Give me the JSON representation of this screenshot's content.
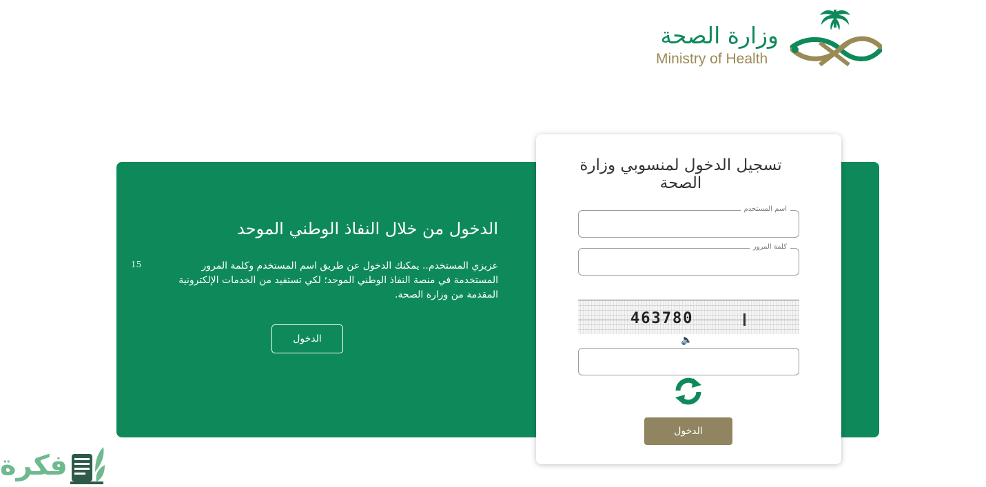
{
  "header": {
    "logo_arabic": "وزارة الصحة",
    "logo_english": "Ministry of Health"
  },
  "nafath": {
    "title": "الدخول من خلال النفاذ الوطني الموحد",
    "description": "عزيزي المستخدم.. يمكنك الدخول عن طريق اسم المستخدم وكلمة المرور المستخدمة في منصة النفاذ الوطني الموحد؛ لكي تستفيد من الخدمات الإلكترونية المقدمة من وزارة الصحة.",
    "number": "15",
    "button_label": "الدخول"
  },
  "login": {
    "title": "تسجيل الدخول لمنسوبي وزارة الصحة",
    "username_label": "اسم المستخدم",
    "username_value": "",
    "password_label": "كلمة المرور",
    "password_value": "",
    "captcha_text": "463780",
    "captcha_value": "",
    "submit_label": "الدخول"
  },
  "watermark": {
    "text": "فكرة"
  },
  "icons": {
    "audio": "speaker-icon",
    "refresh": "refresh-icon"
  },
  "colors": {
    "primary_green": "#0e8a5a",
    "gold": "#918460",
    "logo_gold": "#9a8a56"
  }
}
